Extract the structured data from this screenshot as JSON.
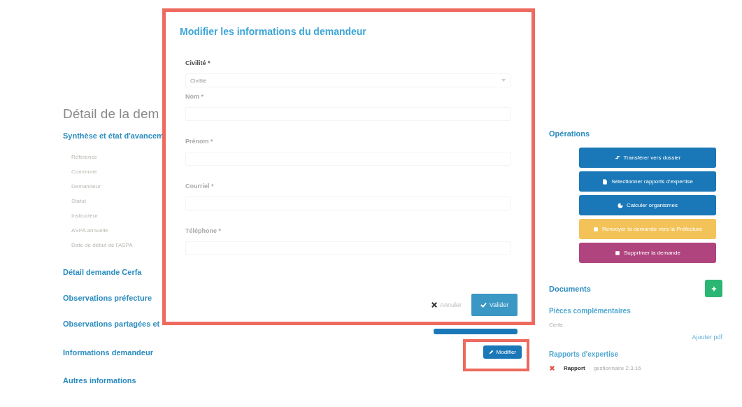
{
  "page": {
    "title": "Détail de la dem",
    "synthesis": {
      "heading": "Synthèse et état d'avancem",
      "lines": [
        "Référence",
        "Commune",
        "Demandeur",
        "Statut",
        "Instructeur",
        "ASPA annuelle",
        "Date de début de l'ASPA"
      ]
    },
    "sections": [
      "Détail demande Cerfa",
      "Observations préfecture",
      "Observations partagées et",
      "Informations demandeur",
      "Autres informations"
    ],
    "edit_button": "Modifier"
  },
  "operations": {
    "heading": "Opérations",
    "buttons": [
      {
        "label": "Transférer vers dossier",
        "color": "#1a78b8"
      },
      {
        "label": "Sélectionner rapports d'expertise",
        "color": "#1a78b8"
      },
      {
        "label": "Calculer organismes",
        "color": "#1a78b8"
      },
      {
        "label": "Renvoyer la demande vers la Préfecture",
        "color": "#f3c35a"
      },
      {
        "label": "Supprimer la demande",
        "color": "#b0447f"
      }
    ]
  },
  "documents": {
    "heading": "Documents",
    "supplementary_heading": "Pièces complémentaires",
    "supplementary_items": [
      "Cerfa"
    ],
    "add_link": "Ajouter pdf",
    "reports_heading": "Rapports d'expertise",
    "reports": [
      {
        "name": "Rapport",
        "detail": "gestionnaire 2.3.16"
      }
    ]
  },
  "modal": {
    "title": "Modifier les informations du demandeur",
    "fields": [
      {
        "label": "Civilité *",
        "kind": "select",
        "placeholder": "Civilité"
      },
      {
        "label": "Nom *",
        "kind": "text"
      },
      {
        "label": "Prénom *",
        "kind": "text"
      },
      {
        "label": "Courriel *",
        "kind": "text"
      },
      {
        "label": "Téléphone *",
        "kind": "text"
      }
    ],
    "cancel": "Annuler",
    "submit": "Valider"
  }
}
